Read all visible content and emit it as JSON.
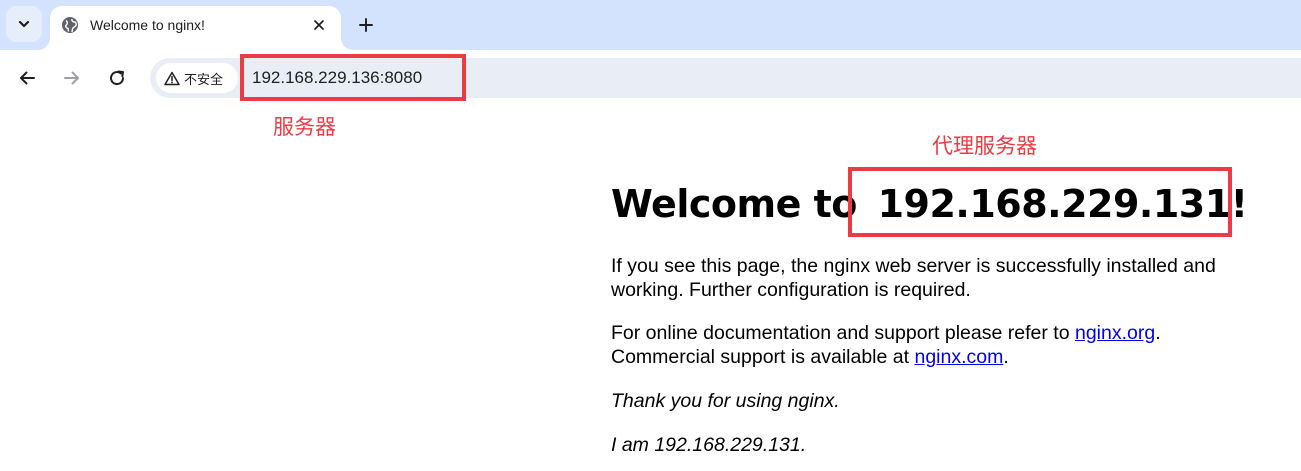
{
  "browser": {
    "tab": {
      "title": "Welcome to nginx!"
    },
    "toolbar": {
      "security_label": "不安全",
      "url": "192.168.229.136:8080"
    }
  },
  "annotations": {
    "server_label": "服务器",
    "proxy_label": "代理服务器",
    "accent_color": "#ee3a43"
  },
  "page": {
    "heading_prefix": "Welcome to",
    "heading_host": "192.168.229.131!",
    "para1_line1": "If you see this page, the nginx web server is successfully installed and",
    "para1_line2": "working. Further configuration is required.",
    "para2_line1_text": "For online documentation and support please refer to ",
    "para2_link1": "nginx.org",
    "para2_line1_end": ".",
    "para2_line2_text": "Commercial support is available at ",
    "para2_link2": "nginx.com",
    "para2_line2_end": ".",
    "thanks": "Thank you for using nginx.",
    "iam": "I am 192.168.229.131."
  },
  "icons": {
    "tab_search": "chevron-down-icon",
    "favicon": "globe-icon",
    "tab_close": "close-icon",
    "new_tab": "plus-icon",
    "back": "arrow-left-icon",
    "forward": "arrow-right-icon",
    "reload": "reload-icon",
    "warning": "warning-triangle-icon"
  }
}
